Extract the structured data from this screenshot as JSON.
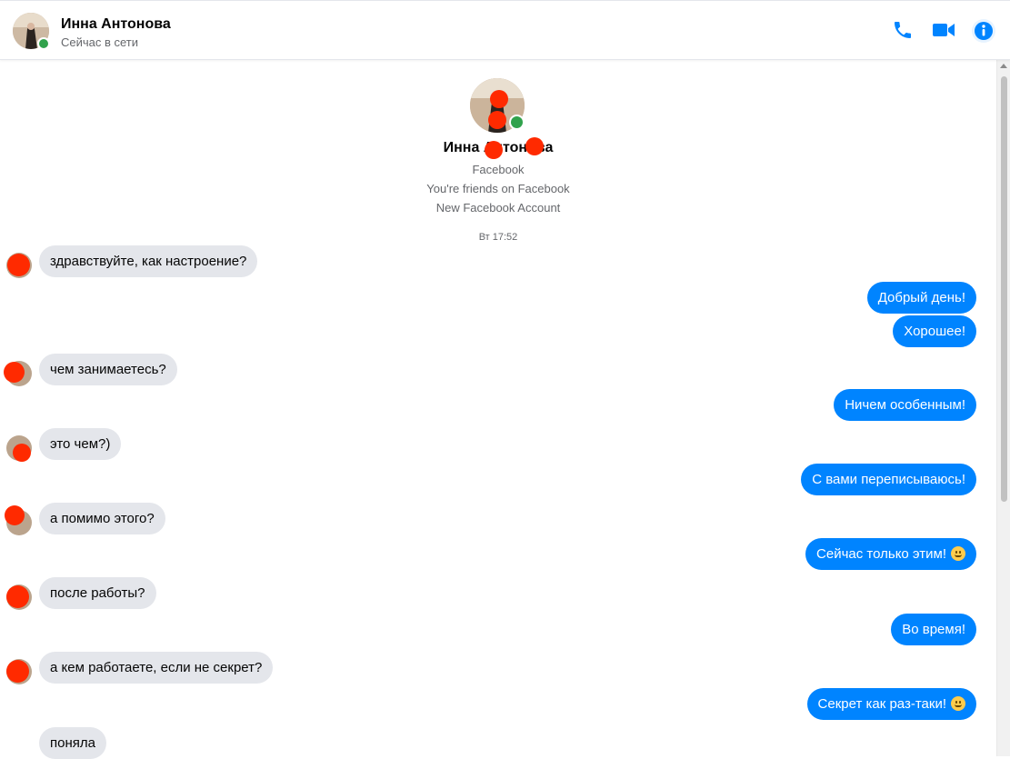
{
  "header": {
    "name": "Инна Антонова",
    "status": "Сейчас в сети",
    "icons": [
      "phone-icon",
      "video-camera-icon",
      "info-icon"
    ]
  },
  "profile": {
    "name": "Инна Антонова",
    "line1": "Facebook",
    "line2": "You're friends on Facebook",
    "line3": "New Facebook Account"
  },
  "timestamp": "Вт 17:52",
  "messages": [
    {
      "dir": "in",
      "text": "здравствуйте, как настроение?"
    },
    {
      "dir": "out",
      "text": "Добрый день!"
    },
    {
      "dir": "out",
      "text": "Хорошее!"
    },
    {
      "dir": "in",
      "text": "чем занимаетесь?"
    },
    {
      "dir": "out",
      "text": "Ничем особенным!"
    },
    {
      "dir": "in",
      "text": "это чем?)"
    },
    {
      "dir": "out",
      "text": "С вами переписываюсь!"
    },
    {
      "dir": "in",
      "text": "а помимо этого?"
    },
    {
      "dir": "out",
      "text": "Сейчас только этим!",
      "emoji": "slightly-smiling-face"
    },
    {
      "dir": "in",
      "text": "после работы?"
    },
    {
      "dir": "out",
      "text": "Во время!"
    },
    {
      "dir": "in",
      "text": "а кем работаете, если не секрет?"
    },
    {
      "dir": "out",
      "text": "Секрет как раз-таки!",
      "emoji": "slightly-smiling-face"
    },
    {
      "dir": "in",
      "text": "поняла"
    }
  ],
  "colors": {
    "accent": "#0084ff",
    "incoming_bubble": "#e4e6eb",
    "online": "#31a24c",
    "redaction": "#ff2a00"
  }
}
